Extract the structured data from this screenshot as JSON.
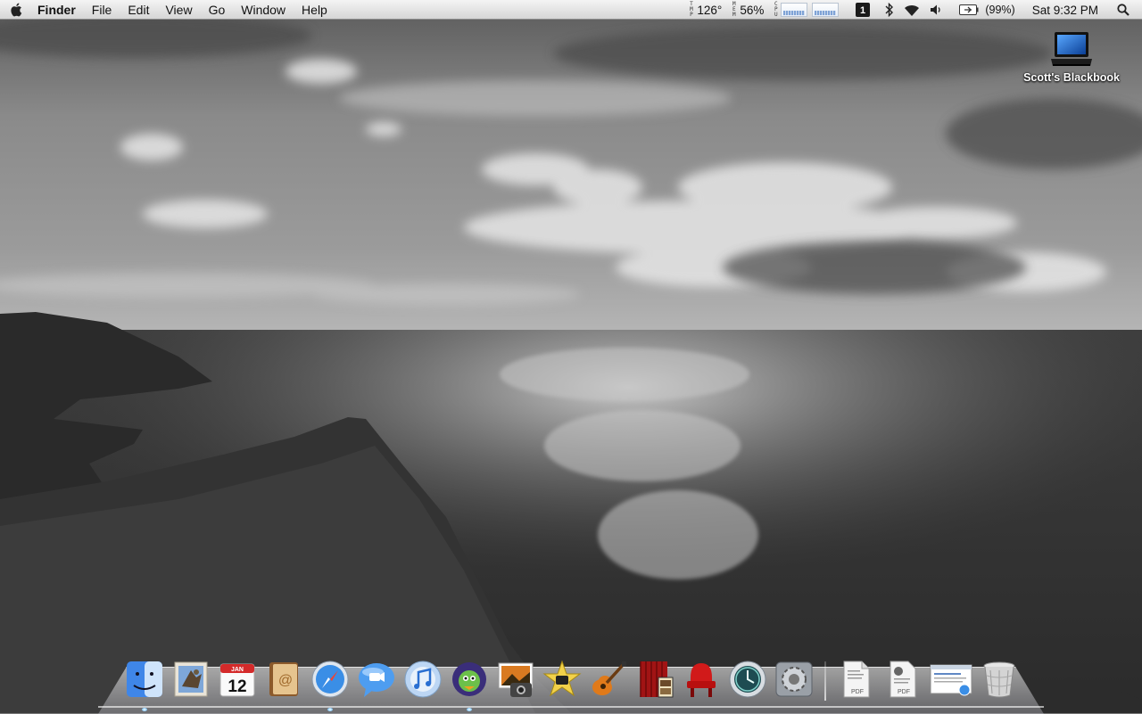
{
  "menubar": {
    "app_name": "Finder",
    "menus": [
      "File",
      "Edit",
      "View",
      "Go",
      "Window",
      "Help"
    ],
    "status": {
      "temp_label": [
        "T",
        "M",
        "P"
      ],
      "temperature": "126°",
      "mem_label": [
        "M",
        "E",
        "M"
      ],
      "memory": "56%",
      "cpu_label": [
        "C",
        "P",
        "U"
      ],
      "battery_percent": "(99%)",
      "clock": "Sat 9:32 PM"
    }
  },
  "desktop": {
    "icons": [
      {
        "label": "Scott's Blackbook",
        "icon": "laptop-icon"
      }
    ]
  },
  "dock": {
    "apps": [
      {
        "name": "Finder",
        "icon": "finder-icon",
        "running": true
      },
      {
        "name": "Mail",
        "icon": "mail-icon",
        "running": false
      },
      {
        "name": "iCal",
        "icon": "ical-icon",
        "running": false,
        "month": "JAN",
        "day": "12"
      },
      {
        "name": "Address Book",
        "icon": "address-book-icon",
        "running": false
      },
      {
        "name": "Safari",
        "icon": "safari-icon",
        "running": true
      },
      {
        "name": "iChat",
        "icon": "ichat-icon",
        "running": false
      },
      {
        "name": "iTunes",
        "icon": "itunes-icon",
        "running": false
      },
      {
        "name": "Adium",
        "icon": "adium-icon",
        "running": true
      },
      {
        "name": "iPhoto",
        "icon": "iphoto-icon",
        "running": false
      },
      {
        "name": "iMovie",
        "icon": "imovie-icon",
        "running": false
      },
      {
        "name": "GarageBand",
        "icon": "garageband-icon",
        "running": false
      },
      {
        "name": "Front Row",
        "icon": "front-row-icon",
        "running": false
      },
      {
        "name": "Theater",
        "icon": "theater-icon",
        "running": false
      },
      {
        "name": "Time Machine",
        "icon": "time-machine-icon",
        "running": false
      },
      {
        "name": "System Preferences",
        "icon": "system-preferences-icon",
        "running": false
      }
    ],
    "docs": [
      {
        "name": "Documents",
        "icon": "pdf-stack-icon",
        "badge": "PDF"
      },
      {
        "name": "Downloads",
        "icon": "pdf-stack-icon",
        "badge": "PDF"
      },
      {
        "name": "Web Clip",
        "icon": "web-document-icon"
      },
      {
        "name": "Trash",
        "icon": "trash-icon"
      }
    ]
  }
}
